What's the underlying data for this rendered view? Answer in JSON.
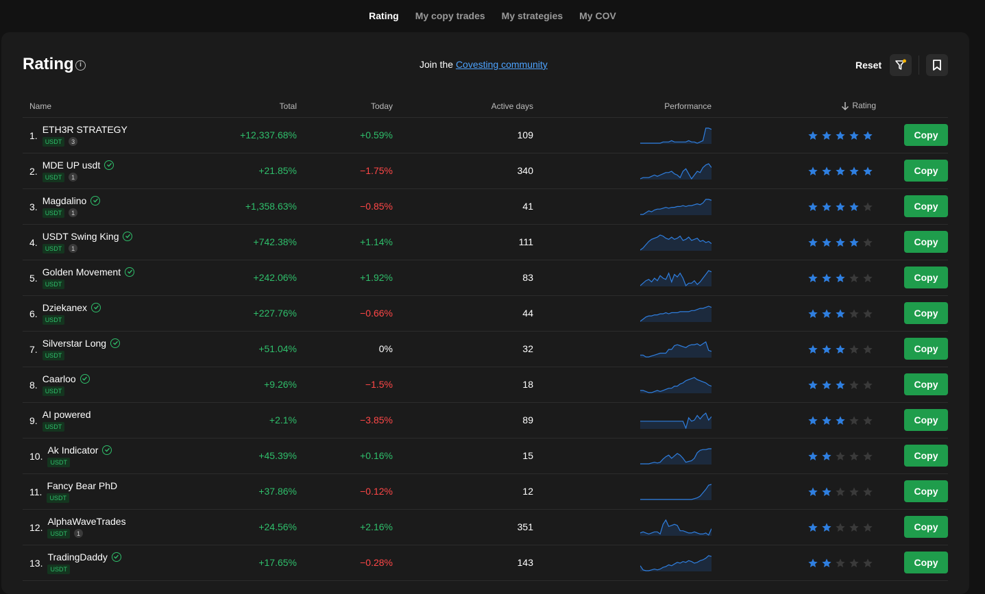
{
  "nav": {
    "tabs": [
      {
        "label": "Rating",
        "active": true
      },
      {
        "label": "My copy trades",
        "active": false
      },
      {
        "label": "My strategies",
        "active": false
      },
      {
        "label": "My COV",
        "active": false
      }
    ]
  },
  "header": {
    "title": "Rating",
    "join_prefix": "Join the ",
    "join_link": "Covesting community",
    "reset_label": "Reset"
  },
  "table": {
    "columns": {
      "name": "Name",
      "total": "Total",
      "today": "Today",
      "active_days": "Active days",
      "performance": "Performance",
      "rating": "Rating"
    },
    "copy_label": "Copy",
    "rows": [
      {
        "rank": "1.",
        "name": "ETH3R STRATEGY",
        "verified": false,
        "currency": "USDT",
        "followers": "3",
        "total": "+12,337.68%",
        "today": "+0.59%",
        "today_sign": "pos",
        "days": "109",
        "stars": 5,
        "spark": [
          2,
          2,
          2,
          2,
          2,
          2,
          2,
          2,
          3,
          3,
          3,
          4,
          3,
          3,
          3,
          3,
          3,
          4,
          3,
          3,
          2,
          3,
          4,
          14,
          14,
          13
        ]
      },
      {
        "rank": "2.",
        "name": "MDE UP usdt",
        "verified": true,
        "currency": "USDT",
        "followers": "1",
        "total": "+21.85%",
        "today": "-1.75%",
        "today_sign": "neg",
        "days": "340",
        "stars": 5,
        "spark": [
          3,
          4,
          4,
          4,
          5,
          6,
          5,
          6,
          7,
          8,
          8,
          9,
          7,
          6,
          4,
          9,
          11,
          7,
          3,
          6,
          9,
          8,
          12,
          14,
          15,
          12
        ]
      },
      {
        "rank": "3.",
        "name": "Magdalino",
        "verified": true,
        "currency": "USDT",
        "followers": "1",
        "total": "+1,358.63%",
        "today": "-0.85%",
        "today_sign": "neg",
        "days": "41",
        "stars": 4,
        "spark": [
          2,
          2,
          4,
          6,
          5,
          7,
          8,
          8,
          9,
          10,
          9,
          10,
          10,
          11,
          11,
          12,
          11,
          12,
          12,
          13,
          14,
          13,
          15,
          19,
          19,
          18
        ]
      },
      {
        "rank": "4.",
        "name": "USDT Swing King",
        "verified": true,
        "currency": "USDT",
        "followers": "1",
        "total": "+742.38%",
        "today": "+1.14%",
        "today_sign": "pos",
        "days": "111",
        "stars": 4,
        "spark": [
          2,
          4,
          7,
          10,
          12,
          13,
          14,
          16,
          15,
          13,
          12,
          14,
          12,
          13,
          15,
          11,
          12,
          14,
          11,
          12,
          13,
          10,
          11,
          9,
          10,
          8
        ]
      },
      {
        "rank": "5.",
        "name": "Golden Movement",
        "verified": true,
        "currency": "USDT",
        "followers": "",
        "total": "+242.06%",
        "today": "+1.92%",
        "today_sign": "pos",
        "days": "83",
        "stars": 3,
        "spark": [
          6,
          8,
          10,
          11,
          9,
          12,
          10,
          14,
          12,
          11,
          16,
          9,
          15,
          13,
          16,
          12,
          6,
          8,
          8,
          10,
          7,
          9,
          12,
          15,
          18,
          17
        ]
      },
      {
        "rank": "6.",
        "name": "Dziekanex",
        "verified": true,
        "currency": "USDT",
        "followers": "",
        "total": "+227.76%",
        "today": "-0.66%",
        "today_sign": "neg",
        "days": "44",
        "stars": 3,
        "spark": [
          3,
          5,
          7,
          8,
          8,
          9,
          9,
          10,
          10,
          11,
          10,
          11,
          11,
          11,
          12,
          12,
          12,
          12,
          13,
          13,
          14,
          15,
          15,
          16,
          17,
          16
        ]
      },
      {
        "rank": "7.",
        "name": "Silverstar Long",
        "verified": true,
        "currency": "USDT",
        "followers": "",
        "total": "+51.04%",
        "today": "0%",
        "today_sign": "neu",
        "days": "32",
        "stars": 3,
        "spark": [
          6,
          6,
          4,
          4,
          5,
          6,
          7,
          8,
          8,
          8,
          12,
          12,
          16,
          17,
          16,
          15,
          14,
          16,
          17,
          17,
          18,
          16,
          18,
          20,
          11,
          10
        ]
      },
      {
        "rank": "8.",
        "name": "Caarloo",
        "verified": true,
        "currency": "USDT",
        "followers": "",
        "total": "+9.26%",
        "today": "-1.5%",
        "today_sign": "neg",
        "days": "18",
        "stars": 3,
        "spark": [
          6,
          6,
          5,
          4,
          4,
          5,
          6,
          5,
          6,
          7,
          8,
          8,
          10,
          10,
          12,
          13,
          15,
          16,
          17,
          18,
          16,
          15,
          14,
          13,
          11,
          10
        ]
      },
      {
        "rank": "9.",
        "name": "AI powered",
        "verified": false,
        "currency": "USDT",
        "followers": "",
        "total": "+2.1%",
        "today": "-3.85%",
        "today_sign": "neg",
        "days": "89",
        "stars": 3,
        "spark": [
          9,
          9,
          9,
          9,
          9,
          9,
          9,
          9,
          9,
          9,
          9,
          9,
          9,
          9,
          9,
          9,
          3,
          12,
          9,
          10,
          14,
          11,
          14,
          16,
          10,
          13
        ]
      },
      {
        "rank": "10.",
        "name": "Ak Indicator",
        "verified": true,
        "currency": "USDT",
        "followers": "",
        "total": "+45.39%",
        "today": "+0.16%",
        "today_sign": "pos",
        "days": "15",
        "stars": 2,
        "spark": [
          2,
          2,
          2,
          2,
          3,
          4,
          3,
          4,
          8,
          11,
          13,
          9,
          12,
          15,
          13,
          9,
          4,
          5,
          6,
          9,
          16,
          19,
          20,
          20,
          21,
          21
        ]
      },
      {
        "rank": "11.",
        "name": "Fancy Bear PhD",
        "verified": false,
        "currency": "USDT",
        "followers": "",
        "total": "+37.86%",
        "today": "-0.12%",
        "today_sign": "neg",
        "days": "12",
        "stars": 2,
        "spark": [
          2,
          2,
          2,
          2,
          2,
          2,
          2,
          2,
          2,
          2,
          2,
          2,
          2,
          2,
          2,
          2,
          2,
          2,
          2,
          3,
          4,
          6,
          10,
          14,
          19,
          20
        ]
      },
      {
        "rank": "12.",
        "name": "AlphaWaveTrades",
        "verified": false,
        "currency": "USDT",
        "followers": "1",
        "total": "+24.56%",
        "today": "+2.16%",
        "today_sign": "pos",
        "days": "351",
        "stars": 2,
        "spark": [
          6,
          7,
          6,
          5,
          6,
          7,
          7,
          5,
          14,
          18,
          12,
          13,
          14,
          13,
          8,
          8,
          7,
          6,
          6,
          7,
          6,
          5,
          5,
          6,
          4,
          10
        ]
      },
      {
        "rank": "13.",
        "name": "TradingDaddy",
        "verified": true,
        "currency": "USDT",
        "followers": "",
        "total": "+17.65%",
        "today": "-0.28%",
        "today_sign": "neg",
        "days": "143",
        "stars": 2,
        "spark": [
          8,
          3,
          2,
          2,
          3,
          4,
          3,
          4,
          6,
          7,
          9,
          8,
          10,
          12,
          11,
          13,
          12,
          14,
          13,
          11,
          12,
          14,
          15,
          17,
          20,
          19
        ]
      }
    ]
  },
  "colors": {
    "positive": "#2fbf6b",
    "negative": "#ff4747",
    "star_active": "#2f7fe0",
    "star_inactive": "#3a3a3a",
    "copy_button": "#1f9d4c",
    "link": "#4da3ff",
    "sparkline": "#2f7fe0"
  }
}
